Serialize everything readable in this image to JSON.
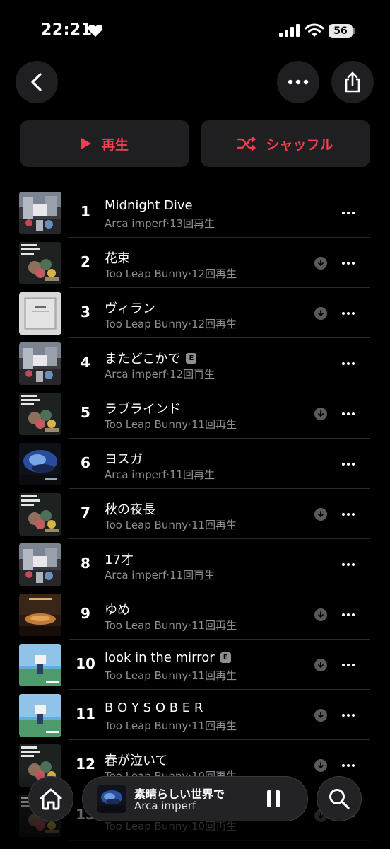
{
  "status_bar": {
    "time": "22:21",
    "battery": "56"
  },
  "actions": {
    "play_label": "再生",
    "shuffle_label": "シャッフル"
  },
  "accent_color": "#f83c4f",
  "tracks": [
    {
      "number": "1",
      "title": "Midnight Dive",
      "artist": "Arca imperf",
      "plays": "13回再生",
      "explicit": false,
      "downloaded": false,
      "art": "art-a"
    },
    {
      "number": "2",
      "title": "花束",
      "artist": "Too Leap Bunny",
      "plays": "12回再生",
      "explicit": false,
      "downloaded": true,
      "art": "art-b"
    },
    {
      "number": "3",
      "title": "ヴィラン",
      "artist": "Too Leap Bunny",
      "plays": "12回再生",
      "explicit": false,
      "downloaded": true,
      "art": "art-c"
    },
    {
      "number": "4",
      "title": "またどこかで",
      "artist": "Arca imperf",
      "plays": "12回再生",
      "explicit": true,
      "downloaded": false,
      "art": "art-a"
    },
    {
      "number": "5",
      "title": "ラブラインド",
      "artist": "Too Leap Bunny",
      "plays": "11回再生",
      "explicit": false,
      "downloaded": true,
      "art": "art-b"
    },
    {
      "number": "6",
      "title": "ヨスガ",
      "artist": "Arca imperf",
      "plays": "11回再生",
      "explicit": false,
      "downloaded": false,
      "art": "art-d"
    },
    {
      "number": "7",
      "title": "秋の夜長",
      "artist": "Too Leap Bunny",
      "plays": "11回再生",
      "explicit": false,
      "downloaded": true,
      "art": "art-b"
    },
    {
      "number": "8",
      "title": "17才",
      "artist": "Arca imperf",
      "plays": "11回再生",
      "explicit": false,
      "downloaded": false,
      "art": "art-a"
    },
    {
      "number": "9",
      "title": "ゆめ",
      "artist": "Too Leap Bunny",
      "plays": "11回再生",
      "explicit": false,
      "downloaded": true,
      "art": "art-e"
    },
    {
      "number": "10",
      "title": "look in the mirror",
      "artist": "Too Leap Bunny",
      "plays": "11回再生",
      "explicit": true,
      "downloaded": true,
      "art": "art-f"
    },
    {
      "number": "11",
      "title": "B O Y S O B E R",
      "artist": "Too Leap Bunny",
      "plays": "11回再生",
      "explicit": false,
      "downloaded": true,
      "art": "art-f"
    },
    {
      "number": "12",
      "title": "春が泣いて",
      "artist": "Too Leap Bunny",
      "plays": "10回再生",
      "explicit": false,
      "downloaded": true,
      "art": "art-b"
    },
    {
      "number": "13",
      "title": "",
      "artist": "Too Leap Bunny",
      "plays": "10回再生",
      "explicit": true,
      "downloaded": true,
      "art": "art-b"
    }
  ],
  "now_playing": {
    "title": "素晴らしい世界で",
    "artist": "Arca imperf",
    "art": "art-d"
  },
  "icons": [
    "chevron-left-icon",
    "ellipsis-icon",
    "share-icon",
    "play-icon",
    "shuffle-icon",
    "download-icon",
    "home-icon",
    "search-icon",
    "pause-icon",
    "heart-icon",
    "signal-icon",
    "wifi-icon"
  ]
}
